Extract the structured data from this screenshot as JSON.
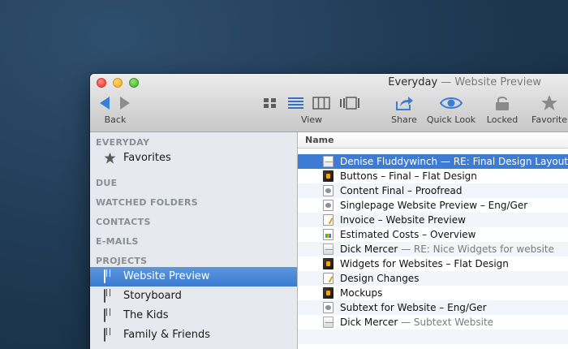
{
  "window": {
    "title": "Everyday",
    "subtitle": "— Website Preview"
  },
  "toolbar": {
    "back_label": "Back",
    "view_label": "View",
    "share_label": "Share",
    "quicklook_label": "Quick Look",
    "locked_label": "Locked",
    "favorite_label": "Favorite"
  },
  "sidebar": {
    "everyday_header": "EVERYDAY",
    "favorites_label": "Favorites",
    "due_header": "DUE",
    "watched_header": "WATCHED FOLDERS",
    "contacts_header": "CONTACTS",
    "emails_header": "E-MAILS",
    "projects_header": "PROJECTS",
    "projects": [
      {
        "label": "Website Preview",
        "selected": true
      },
      {
        "label": "Storyboard",
        "selected": false
      },
      {
        "label": "The Kids",
        "selected": false
      },
      {
        "label": "Family & Friends",
        "selected": false
      }
    ]
  },
  "list": {
    "column_name": "Name",
    "rows": [
      {
        "icon": "mail-icon",
        "title": "Denise Fluddywinch",
        "sub": " — RE: Final Design Layout",
        "selected": true
      },
      {
        "icon": "sketch-file-icon",
        "title": "Buttons – Final – Flat Design",
        "sub": ""
      },
      {
        "icon": "document-icon",
        "title": "Content Final – Proofread",
        "sub": ""
      },
      {
        "icon": "document-icon",
        "title": "Singlepage Website Preview – Eng/Ger",
        "sub": ""
      },
      {
        "icon": "pages-file-icon",
        "title": "Invoice – Website Preview",
        "sub": ""
      },
      {
        "icon": "numbers-file-icon",
        "title": "Estimated Costs – Overview",
        "sub": ""
      },
      {
        "icon": "mail-icon",
        "title": "Dick Mercer",
        "sub": " — RE: Nice Widgets for website"
      },
      {
        "icon": "sketch-file-icon",
        "title": "Widgets for Websites – Flat Design",
        "sub": ""
      },
      {
        "icon": "pages-file-icon",
        "title": "Design Changes",
        "sub": ""
      },
      {
        "icon": "sketch-file-icon",
        "title": "Mockups",
        "sub": ""
      },
      {
        "icon": "document-icon",
        "title": "Subtext for Website – Eng/Ger",
        "sub": ""
      },
      {
        "icon": "mail-icon",
        "title": "Dick Mercer",
        "sub": " — Subtext Website"
      }
    ]
  }
}
